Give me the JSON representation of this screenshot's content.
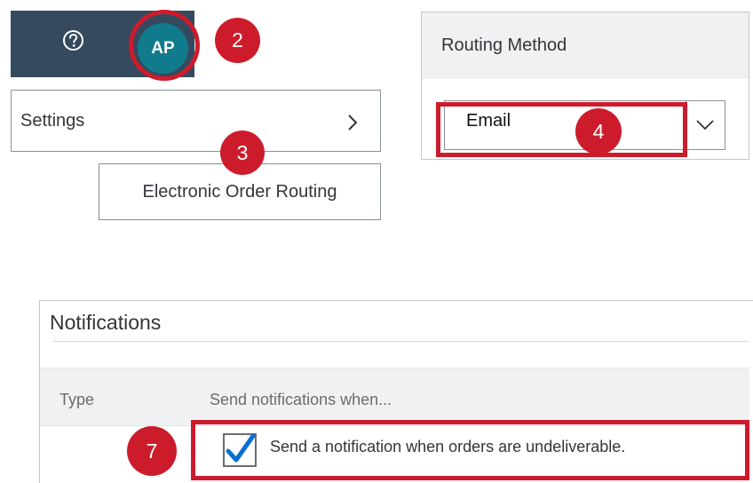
{
  "shellbar": {
    "avatar_initials": "AP",
    "help_icon": "help-circle-icon"
  },
  "callouts": {
    "c2": "2",
    "c3": "3",
    "c4": "4",
    "c7": "7"
  },
  "settings_menu": {
    "settings_label": "Settings",
    "settings_chevron_icon": "chevron-right-icon",
    "submenu_item": "Electronic Order Routing"
  },
  "routing_method": {
    "header": "Routing Method",
    "selected_value": "Email",
    "dropdown_icon": "chevron-down-icon"
  },
  "notifications": {
    "title": "Notifications",
    "columns": [
      "Type",
      "Send notifications when..."
    ],
    "rows": [
      {
        "checked": true,
        "text": "Send a notification when orders are undeliverable."
      }
    ]
  },
  "colors": {
    "shellbar_bg": "#354a5f",
    "avatar_bg": "#0f7b8c",
    "highlight_red": "#cc1c2c",
    "checkmark_blue": "#0a6ed1"
  }
}
